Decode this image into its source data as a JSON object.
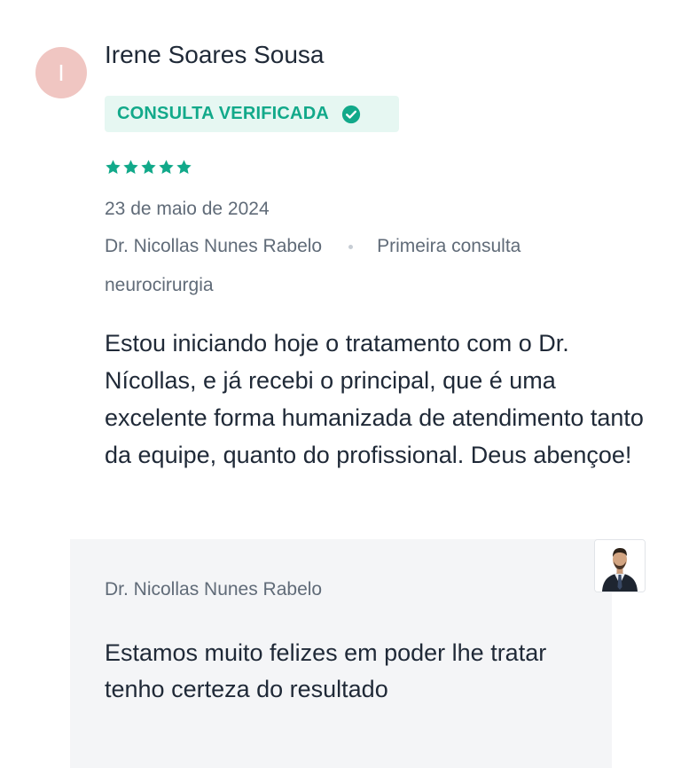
{
  "reviewer": {
    "initial": "I",
    "name": "Irene Soares Sousa"
  },
  "badge": {
    "label": "CONSULTA VERIFICADA",
    "icon": "check-circle-icon",
    "color": "#12a98a",
    "background": "#e6f7f2"
  },
  "rating": {
    "stars": 5,
    "max": 5,
    "color": "#12a98a"
  },
  "date": "23 de maio de 2024",
  "meta": {
    "doctor": "Dr. Nicollas Nunes Rabelo",
    "visit_type": "Primeira consulta",
    "specialty": "neurocirurgia"
  },
  "review_text": "Estou iniciando hoje o tratamento com o Dr. Nícollas, e já recebi o principal, que é uma excelente forma humanizada de atendimento tanto da equipe, quanto do profissional. Deus abençoe!",
  "reply": {
    "author": "Dr. Nicollas Nunes Rabelo",
    "text": "Estamos muito felizes em poder lhe tratar tenho certeza do resultado",
    "photo_icon": "doctor-avatar"
  }
}
